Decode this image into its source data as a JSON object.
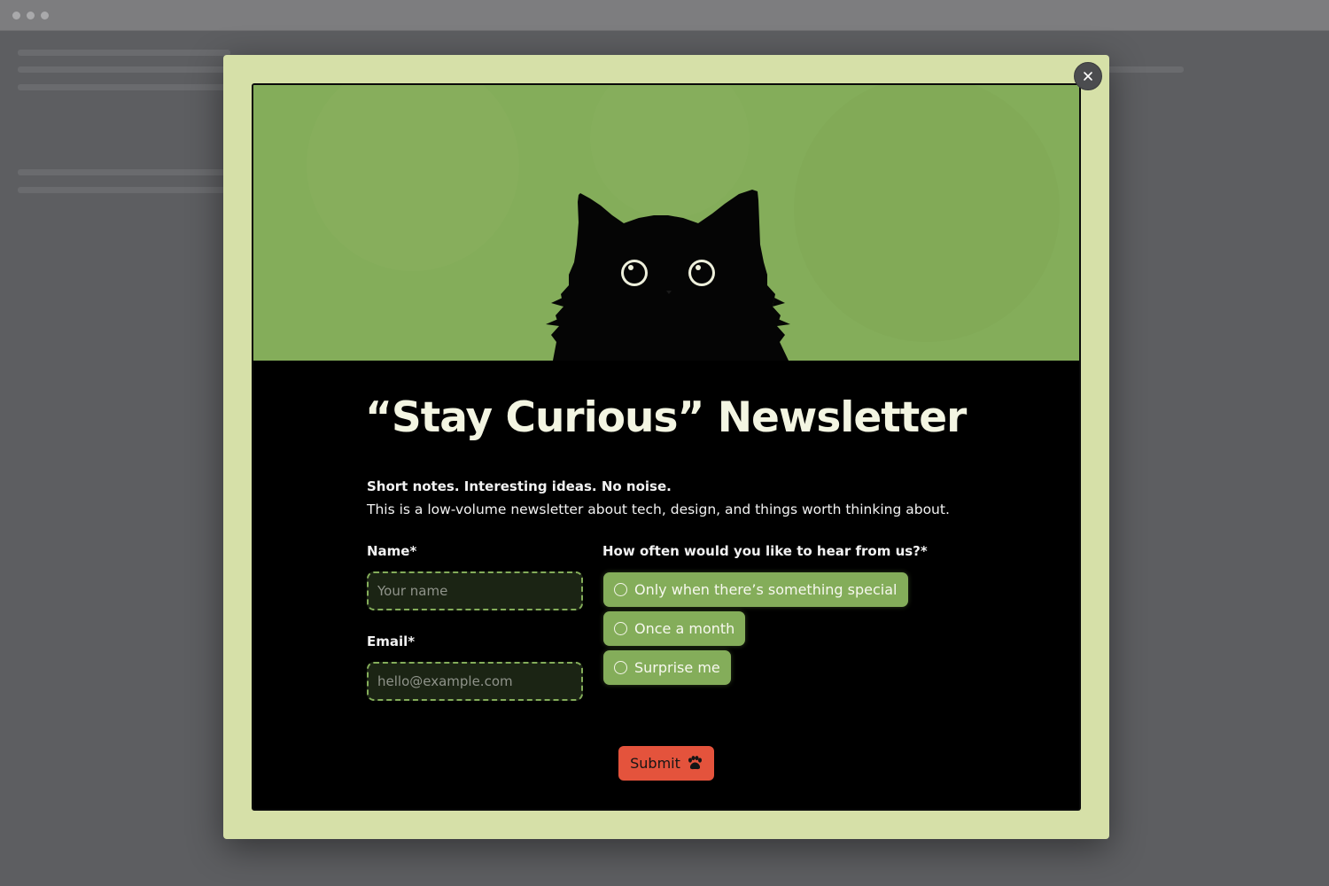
{
  "newsletter": {
    "title": "“Stay Curious” Newsletter",
    "lead": "Short notes. Interesting ideas. No noise.",
    "description": "This is a low-volume newsletter about tech, design, and things worth thinking about."
  },
  "form": {
    "name": {
      "label": "Name*",
      "placeholder": "Your name",
      "value": ""
    },
    "email": {
      "label": "Email*",
      "placeholder": "hello@example.com",
      "value": ""
    },
    "frequency": {
      "label": "How often would you like to hear from us?*",
      "options": [
        {
          "label": "Only when there’s something special",
          "selected": false
        },
        {
          "label": "Once a month",
          "selected": false
        },
        {
          "label": "Surprise me",
          "selected": false
        }
      ]
    },
    "submit_label": "Submit"
  },
  "icons": {
    "close": "close-icon",
    "submit": "paw-icon",
    "hero": "black-cat-illustration"
  },
  "colors": {
    "accent_green": "#84ad5a",
    "modal_bg": "#d6e0a8",
    "submit_red": "#e4533c",
    "card_bg": "#000000"
  }
}
